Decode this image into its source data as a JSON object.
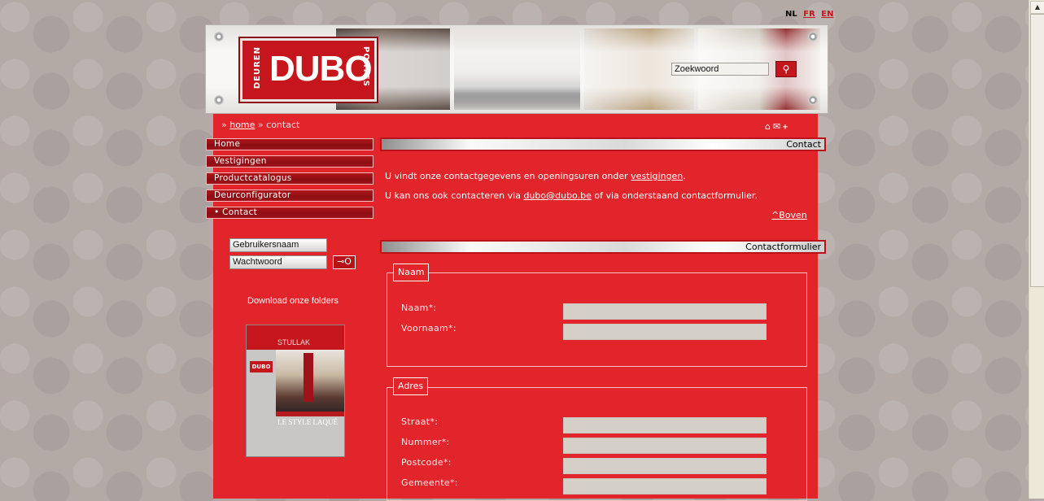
{
  "languages": {
    "current": "NL",
    "fr": "FR",
    "en": "EN"
  },
  "header": {
    "logo_word": "DUBO",
    "logo_left": "DEUREN",
    "logo_right": "PORTES",
    "search_placeholder": "Zoekwoord",
    "search_button_icon": "magnifier-icon"
  },
  "breadcrumb": {
    "sep1": "»",
    "home": "home",
    "sep2": "»",
    "current": "contact"
  },
  "header_icons": [
    "home-icon",
    "mail-icon",
    "sitemap-icon"
  ],
  "nav": {
    "items": [
      {
        "label": "Home"
      },
      {
        "label": "Vestigingen"
      },
      {
        "label": "Productcatalogus"
      },
      {
        "label": "Deurconfigurator"
      },
      {
        "label": "• Contact"
      }
    ]
  },
  "login": {
    "username_placeholder": "Gebruikersnaam",
    "password_placeholder": "Wachtwoord",
    "submit_icon": "key-icon"
  },
  "folders": {
    "title": "Download onze folders",
    "cover_title": "STULLAK",
    "cover_tagline": "LE STYLE LAQUÉ",
    "cover_logo": "DUBO"
  },
  "contact": {
    "section_title": "Contact",
    "line1_prefix": "U vindt onze contactgegevens en openingsuren onder ",
    "line1_link": "vestigingen",
    "line1_suffix": ".",
    "line2_prefix": "U kan ons ook contacteren via ",
    "line2_link": "dubo@dubo.be",
    "line2_suffix": " of via onderstaand contactformulier.",
    "back_to_top": "^Boven"
  },
  "form": {
    "section_title": "Contactformulier",
    "naam_legend": "Naam",
    "naam_label": "Naam*:",
    "voornaam_label": "Voornaam*:",
    "adres_legend": "Adres",
    "straat_label": "Straat*:",
    "nummer_label": "Nummer*:",
    "postcode_label": "Postcode*:",
    "gemeente_label": "Gemeente*:"
  },
  "colors": {
    "brand_red": "#e2242b",
    "dark_red": "#8c0e12",
    "input_bg": "#d4d0c8"
  }
}
